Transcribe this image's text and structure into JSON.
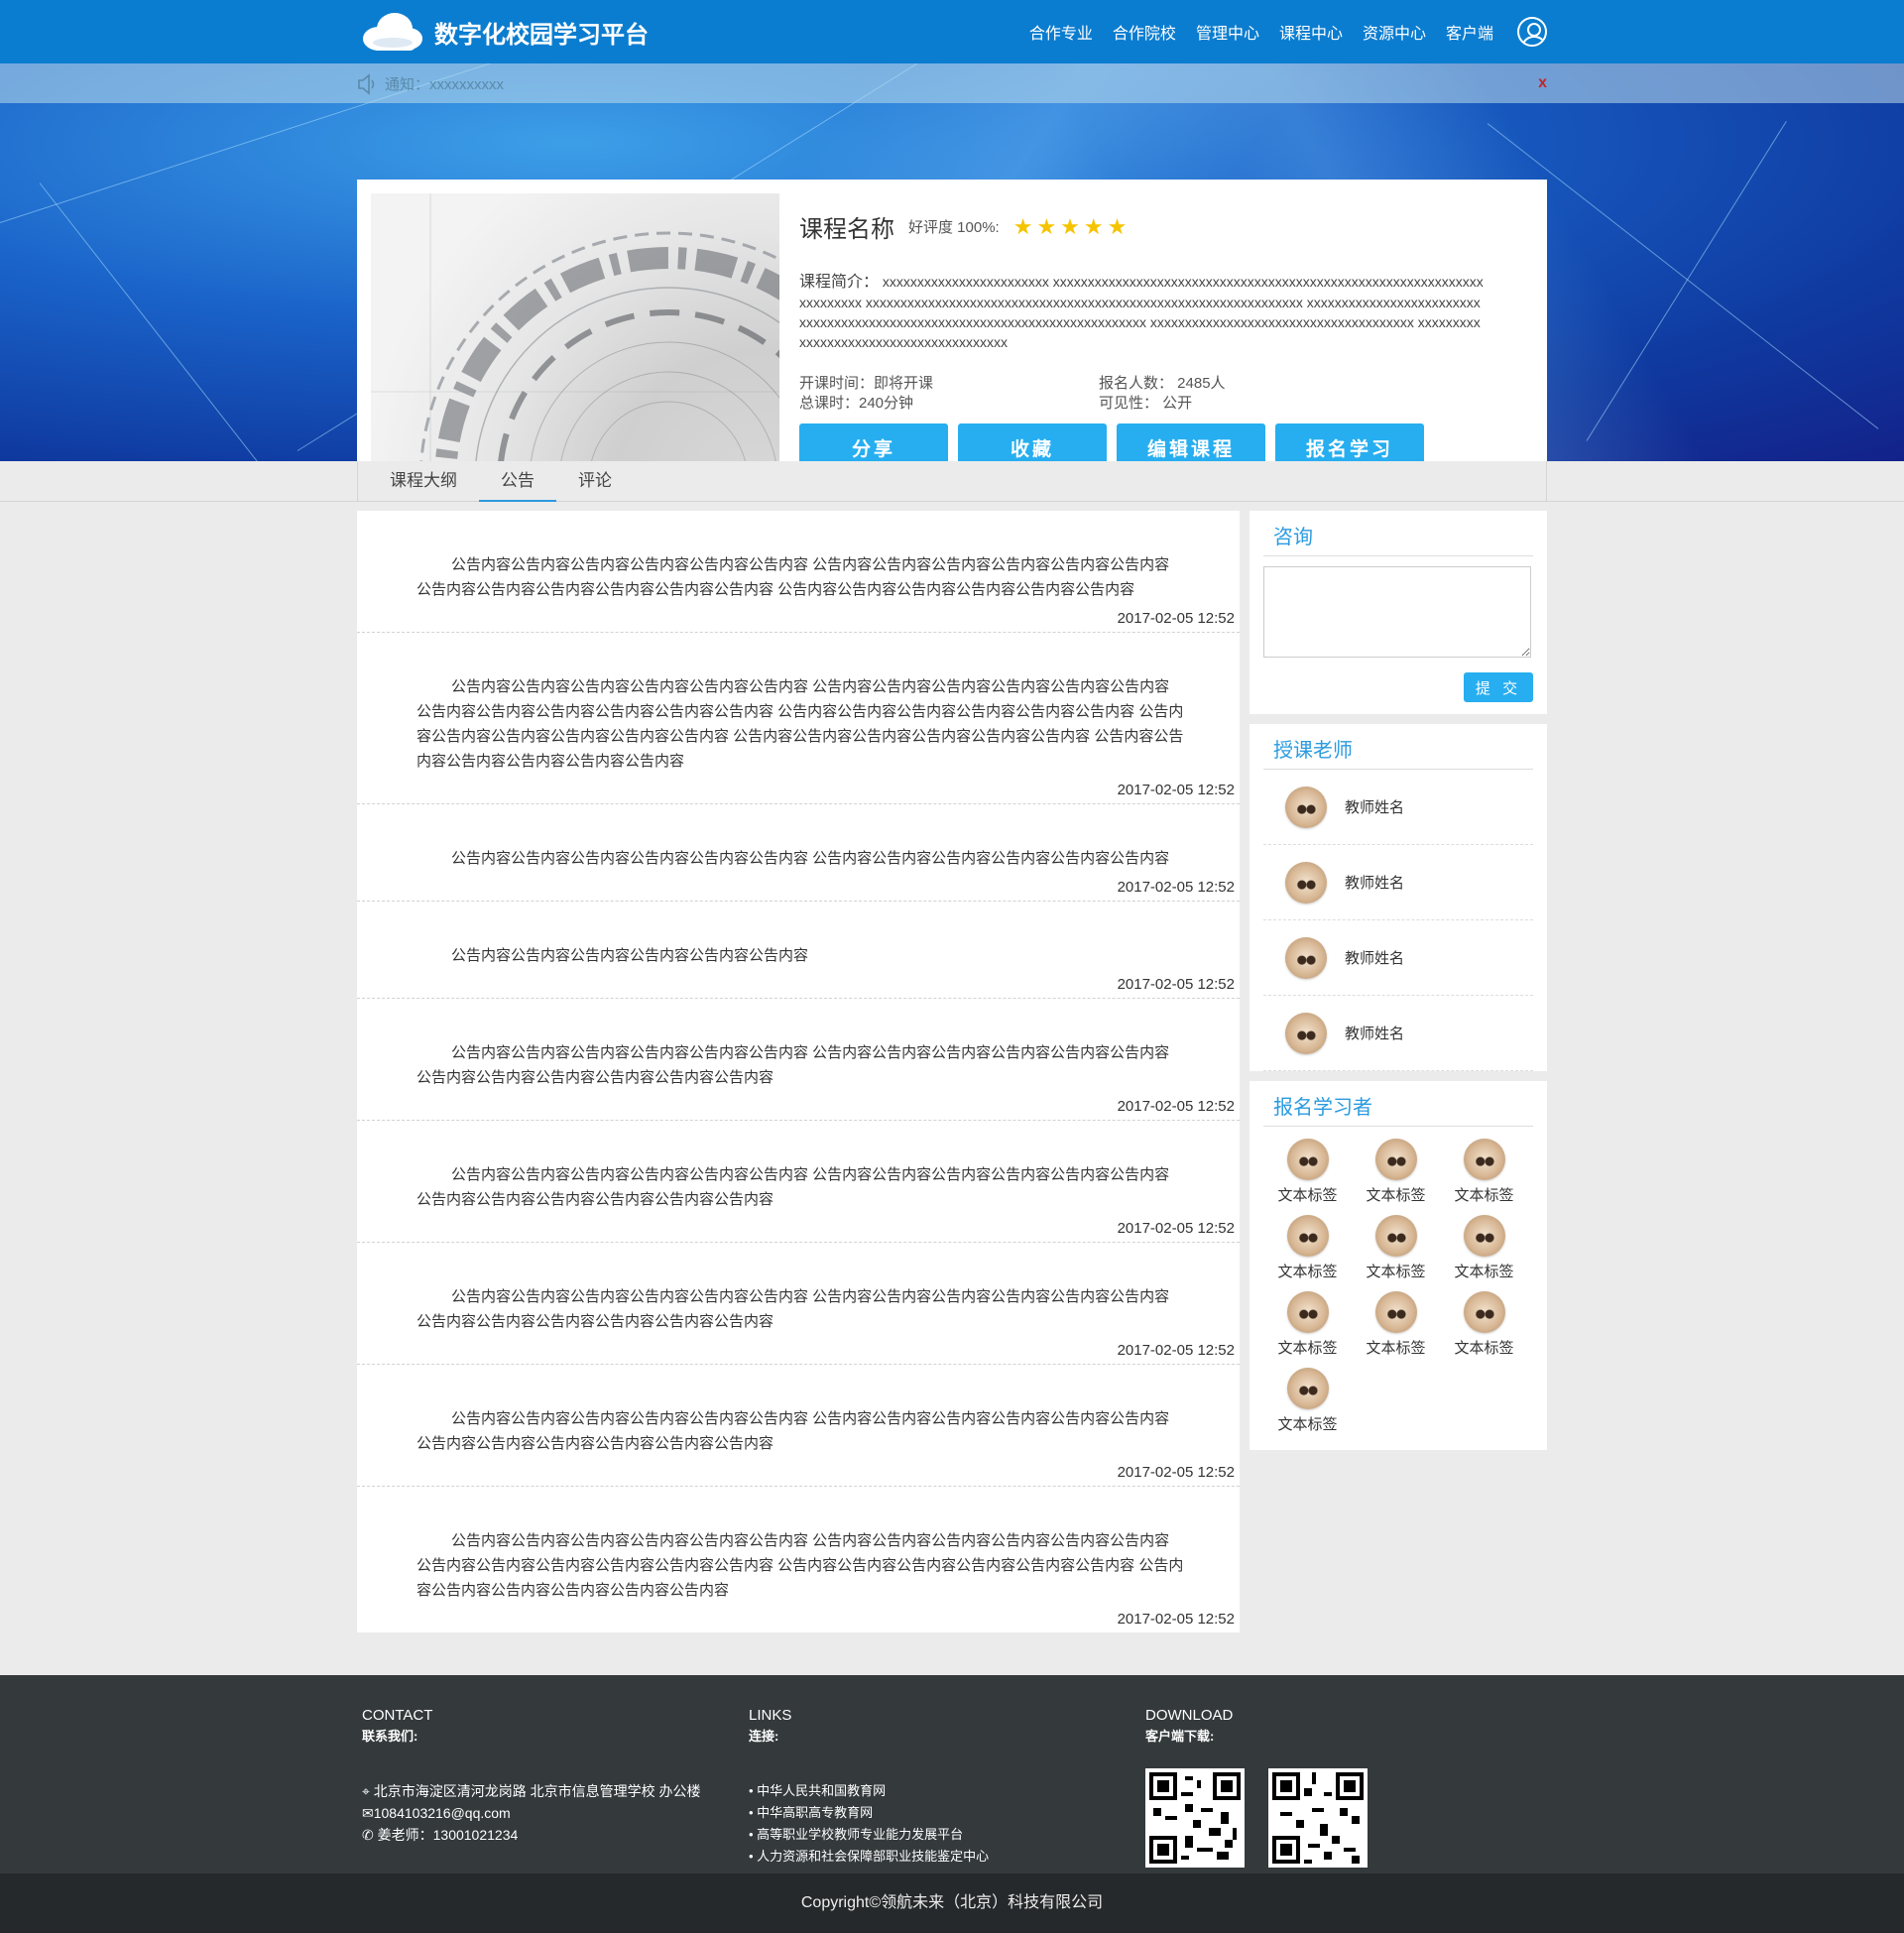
{
  "header": {
    "site_title": "数字化校园学习平台",
    "nav": [
      "合作专业",
      "合作院校",
      "管理中心",
      "课程中心",
      "资源中心",
      "客户端"
    ]
  },
  "notice": {
    "text": "通知：xxxxxxxxxx",
    "close": "x"
  },
  "course": {
    "title": "课程名称",
    "rating": "好评度 100%:",
    "stars": 5,
    "intro_label": "课程简介：",
    "intro_text": "xxxxxxxxxxxxxxxxxxxxxxxx xxxxxxxxxxxxxxxxxxxxxxxxxxxxxxxxxxxxxxxxxxxxxxxxxxxxxxxxxxxxxxxxxxxxxxx xxxxxxxxxxxxxxxxxxxxxxxxxxxxxxxxxxxxxxxxxxxxxxxxxxxxxxxxxxxxxxx xxxxxxxxxxxxxxxxxxxxxxxxxxxxxxxxxxxxxxxxxxxxxxxxxxxxxxxxxxxxxxxxxxxxxxxxxxx xxxxxxxxxxxxxxxxxxxxxxxxxxxxxxxxxxxxxx xxxxxxxxxxxxxxxxxxxxxxxxxxxxxxxxxxxxxxx",
    "start": "开课时间：即将开课",
    "enrolled": "报名人数：  2485人",
    "hours": "总课时：240分钟",
    "visibility": "可见性：  公开",
    "buttons": [
      "分享",
      "收藏",
      "编辑课程",
      "报名学习"
    ]
  },
  "tabs": [
    "课程大纲",
    "公告",
    "评论"
  ],
  "active_tab": "公告",
  "announcements": [
    {
      "text": "公告内容公告内容公告内容公告内容公告内容公告内容 公告内容公告内容公告内容公告内容公告内容公告内容 公告内容公告内容公告内容公告内容公告内容公告内容 公告内容公告内容公告内容公告内容公告内容公告内容",
      "time": "2017-02-05 12:52"
    },
    {
      "text": "公告内容公告内容公告内容公告内容公告内容公告内容 公告内容公告内容公告内容公告内容公告内容公告内容 公告内容公告内容公告内容公告内容公告内容公告内容 公告内容公告内容公告内容公告内容公告内容公告内容 公告内容公告内容公告内容公告内容公告内容公告内容 公告内容公告内容公告内容公告内容公告内容公告内容 公告内容公告内容公告内容公告内容公告内容公告内容",
      "time": "2017-02-05 12:52"
    },
    {
      "text": "公告内容公告内容公告内容公告内容公告内容公告内容 公告内容公告内容公告内容公告内容公告内容公告内容",
      "time": "2017-02-05 12:52"
    },
    {
      "text": "公告内容公告内容公告内容公告内容公告内容公告内容",
      "time": "2017-02-05 12:52"
    },
    {
      "text": "公告内容公告内容公告内容公告内容公告内容公告内容 公告内容公告内容公告内容公告内容公告内容公告内容 公告内容公告内容公告内容公告内容公告内容公告内容",
      "time": "2017-02-05 12:52"
    },
    {
      "text": "公告内容公告内容公告内容公告内容公告内容公告内容 公告内容公告内容公告内容公告内容公告内容公告内容 公告内容公告内容公告内容公告内容公告内容公告内容",
      "time": "2017-02-05 12:52"
    },
    {
      "text": "公告内容公告内容公告内容公告内容公告内容公告内容 公告内容公告内容公告内容公告内容公告内容公告内容 公告内容公告内容公告内容公告内容公告内容公告内容",
      "time": "2017-02-05 12:52"
    },
    {
      "text": "公告内容公告内容公告内容公告内容公告内容公告内容 公告内容公告内容公告内容公告内容公告内容公告内容 公告内容公告内容公告内容公告内容公告内容公告内容",
      "time": "2017-02-05 12:52"
    },
    {
      "text": "公告内容公告内容公告内容公告内容公告内容公告内容 公告内容公告内容公告内容公告内容公告内容公告内容 公告内容公告内容公告内容公告内容公告内容公告内容 公告内容公告内容公告内容公告内容公告内容公告内容 公告内容公告内容公告内容公告内容公告内容公告内容",
      "time": "2017-02-05 12:52"
    }
  ],
  "consult": {
    "title": "咨询",
    "submit": "提 交"
  },
  "teachers": {
    "title": "授课老师",
    "items": [
      "教师姓名",
      "教师姓名",
      "教师姓名",
      "教师姓名"
    ]
  },
  "students": {
    "title": "报名学习者",
    "items": [
      "文本标签",
      "文本标签",
      "文本标签",
      "文本标签",
      "文本标签",
      "文本标签",
      "文本标签",
      "文本标签",
      "文本标签",
      "文本标签"
    ]
  },
  "footer": {
    "contact_title": "CONTACT",
    "contact_sub": "联系我们:",
    "address": "北京市海淀区清河龙岗路 北京市信息管理学校 办公楼",
    "email": "1084103216@qq.com",
    "phone": "姜老师：13001021234",
    "links_title": "LINKS",
    "links_sub": "连接:",
    "links": [
      "中华人民共和国教育网",
      "中华高职高专教育网",
      "高等职业学校教师专业能力发展平台",
      "人力资源和社会保障部职业技能鉴定中心"
    ],
    "download_title": "DOWNLOAD",
    "download_sub": "客户端下载:",
    "copyright": "Copyright©领航未来（北京）科技有限公司"
  },
  "colors": {
    "header_bg": "#0b7dd0",
    "accent": "#27aef0",
    "footer_bg": "#34393c",
    "close_x": "#c0262c",
    "star": "#f5c400"
  }
}
